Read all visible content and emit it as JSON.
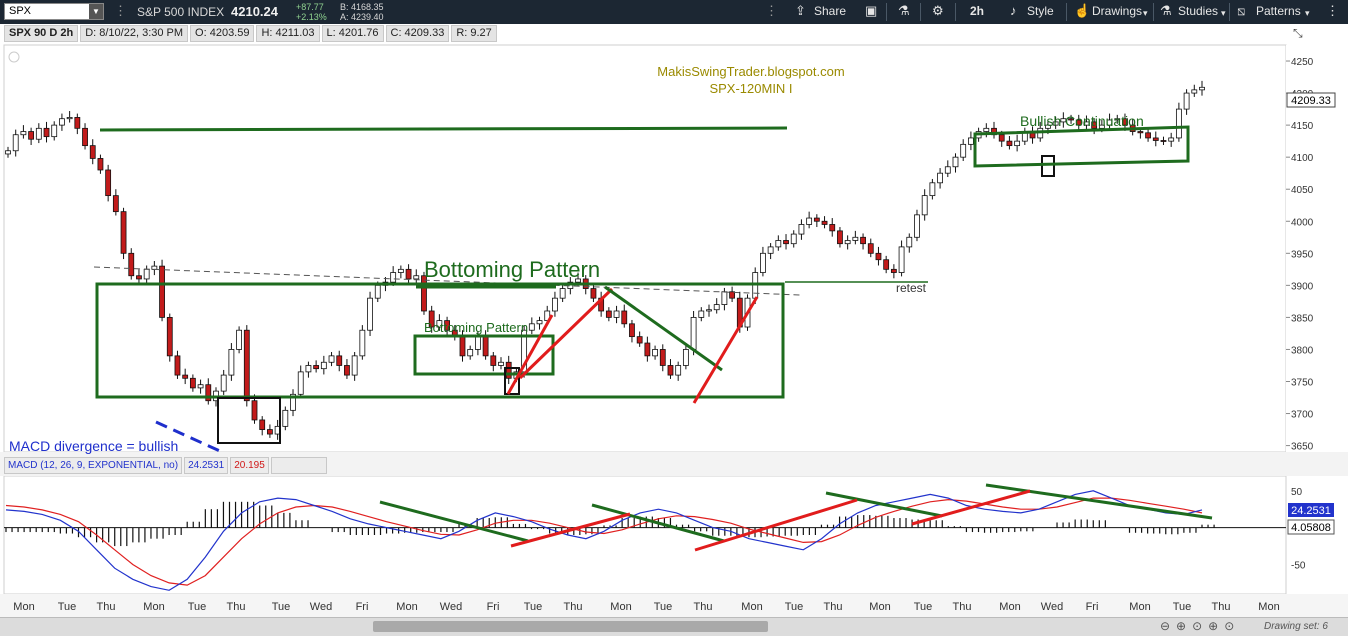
{
  "toolbar": {
    "symbol": "SPX",
    "instrument": "S&P 500 INDEX",
    "last": "4210.24",
    "change_abs": "+87.77",
    "change_pct": "+2.13%",
    "bid": "B: 4168.35",
    "ask": "A: 4239.40",
    "share": "Share",
    "timeframe": "2h",
    "style": "Style",
    "drawings": "Drawings",
    "studies": "Studies",
    "patterns": "Patterns"
  },
  "info": {
    "symbol": "SPX 90 D 2h",
    "date": "D: 8/10/22, 3:30 PM",
    "open": "O: 4203.59",
    "high": "H: 4211.03",
    "low": "L: 4201.76",
    "close": "C: 4209.33",
    "range": "R: 9.27"
  },
  "macd_legend": {
    "label": "MACD (12, 26, 9, EXPONENTIAL, no)",
    "value": "24.2531",
    "avg": "20.195",
    "diff": "4.05808"
  },
  "footer": {
    "drawing_set": "Drawing set: 6"
  },
  "colors": {
    "up_candle": "#ffffff",
    "down_candle": "#c21b1b",
    "annotation_green": "#1e6b1e",
    "trend_red": "#e11c1c",
    "macd_line": "#2233cc",
    "signal_line": "#e02020",
    "watermark": "#9a8a00"
  },
  "chart_data": [
    {
      "type": "candlestick",
      "title": "MakisSwingTrader.blogspot.com",
      "subtitle": "SPX-120MIN  I",
      "y_ticks": [
        3650,
        3700,
        3750,
        3800,
        3850,
        3900,
        3950,
        4000,
        4050,
        4100,
        4150,
        4200,
        4250
      ],
      "ylim": [
        3640,
        4275
      ],
      "last_price_label": "4209.33",
      "x_tick_labels": [
        "Mon",
        "Tue",
        "Thu",
        "Mon",
        "Tue",
        "Thu",
        "Tue",
        "Wed",
        "Fri",
        "Mon",
        "Wed",
        "Fri",
        "Tue",
        "Thu",
        "Mon",
        "Tue",
        "Thu",
        "Mon",
        "Tue",
        "Thu",
        "Mon",
        "Tue",
        "Thu",
        "Mon",
        "Wed",
        "Fri",
        "Mon"
      ],
      "annotations": [
        "Bottoming Pattern",
        "Bottoming Pattern",
        "Bullish Continuation",
        "retest",
        "MACD divergence = bullish"
      ],
      "closes": [
        4110,
        4135,
        4140,
        4128,
        4145,
        4132,
        4150,
        4160,
        4162,
        4145,
        4118,
        4098,
        4080,
        4040,
        4015,
        3950,
        3915,
        3910,
        3925,
        3930,
        3850,
        3790,
        3760,
        3755,
        3740,
        3745,
        3720,
        3735,
        3760,
        3800,
        3830,
        3720,
        3690,
        3675,
        3668,
        3680,
        3705,
        3730,
        3765,
        3775,
        3770,
        3780,
        3790,
        3775,
        3760,
        3790,
        3830,
        3880,
        3900,
        3905,
        3920,
        3925,
        3910,
        3915,
        3860,
        3835,
        3845,
        3830,
        3820,
        3790,
        3800,
        3820,
        3790,
        3775,
        3780,
        3755,
        3765,
        3830,
        3840,
        3845,
        3860,
        3880,
        3895,
        3905,
        3910,
        3895,
        3880,
        3860,
        3850,
        3860,
        3840,
        3820,
        3810,
        3790,
        3800,
        3775,
        3760,
        3775,
        3800,
        3850,
        3860,
        3862,
        3870,
        3890,
        3880,
        3835,
        3880,
        3920,
        3950,
        3960,
        3970,
        3965,
        3980,
        3995,
        4005,
        4000,
        3995,
        3985,
        3965,
        3970,
        3975,
        3965,
        3950,
        3940,
        3925,
        3920,
        3960,
        3975,
        4010,
        4040,
        4060,
        4075,
        4085,
        4100,
        4120,
        4130,
        4140,
        4145,
        4135,
        4125,
        4118,
        4125,
        4140,
        4130,
        4145,
        4150,
        4155,
        4160,
        4158,
        4150,
        4155,
        4145,
        4150,
        4158,
        4160,
        4150,
        4140,
        4138,
        4130,
        4126,
        4125,
        4130,
        4175,
        4200,
        4205,
        4209
      ]
    },
    {
      "type": "line",
      "title": "MACD (12, 26, 9, EXPONENTIAL, no)",
      "y_ticks": [
        50,
        0,
        -50
      ],
      "series": [
        {
          "name": "MACD",
          "values": [
            24,
            22,
            18,
            10,
            -5,
            -30,
            -55,
            -70,
            -80,
            -85,
            -70,
            -40,
            -5,
            20,
            35,
            40,
            38,
            30,
            22,
            12,
            5,
            0,
            -5,
            -10,
            -15,
            -5,
            10,
            20,
            15,
            8,
            -2,
            -10,
            -15,
            -5,
            10,
            20,
            25,
            20,
            10,
            0,
            -5,
            -15,
            -20,
            -25,
            -30,
            -15,
            5,
            20,
            30,
            35,
            40,
            45,
            40,
            30,
            25,
            22,
            20,
            25,
            35,
            45,
            50,
            40,
            30,
            25,
            20,
            18,
            24
          ]
        },
        {
          "name": "Signal",
          "values": [
            30,
            28,
            24,
            18,
            8,
            -10,
            -30,
            -50,
            -65,
            -75,
            -78,
            -65,
            -40,
            -15,
            5,
            20,
            28,
            30,
            28,
            22,
            15,
            8,
            2,
            -4,
            -9,
            -10,
            -3,
            6,
            10,
            10,
            6,
            0,
            -6,
            -8,
            -3,
            5,
            12,
            16,
            15,
            11,
            6,
            -2,
            -8,
            -14,
            -20,
            -19,
            -10,
            3,
            14,
            22,
            29,
            35,
            38,
            36,
            32,
            28,
            25,
            25,
            28,
            34,
            40,
            40,
            37,
            33,
            29,
            25,
            20
          ]
        },
        {
          "name": "Diff",
          "values": [
            -6,
            -6,
            -6,
            -8,
            -13,
            -20,
            -25,
            -20,
            -15,
            -10,
            8,
            25,
            35,
            35,
            30,
            20,
            10,
            0,
            -6,
            -10,
            -10,
            -8,
            -7,
            -6,
            -6,
            5,
            13,
            14,
            5,
            -2,
            -8,
            -10,
            -9,
            3,
            13,
            15,
            13,
            4,
            -5,
            -11,
            -11,
            -13,
            -12,
            -11,
            -10,
            4,
            15,
            17,
            16,
            13,
            11,
            10,
            2,
            -6,
            -7,
            -6,
            -5,
            0,
            7,
            11,
            10,
            0,
            -7,
            -8,
            -9,
            -7,
            4
          ]
        }
      ]
    }
  ]
}
